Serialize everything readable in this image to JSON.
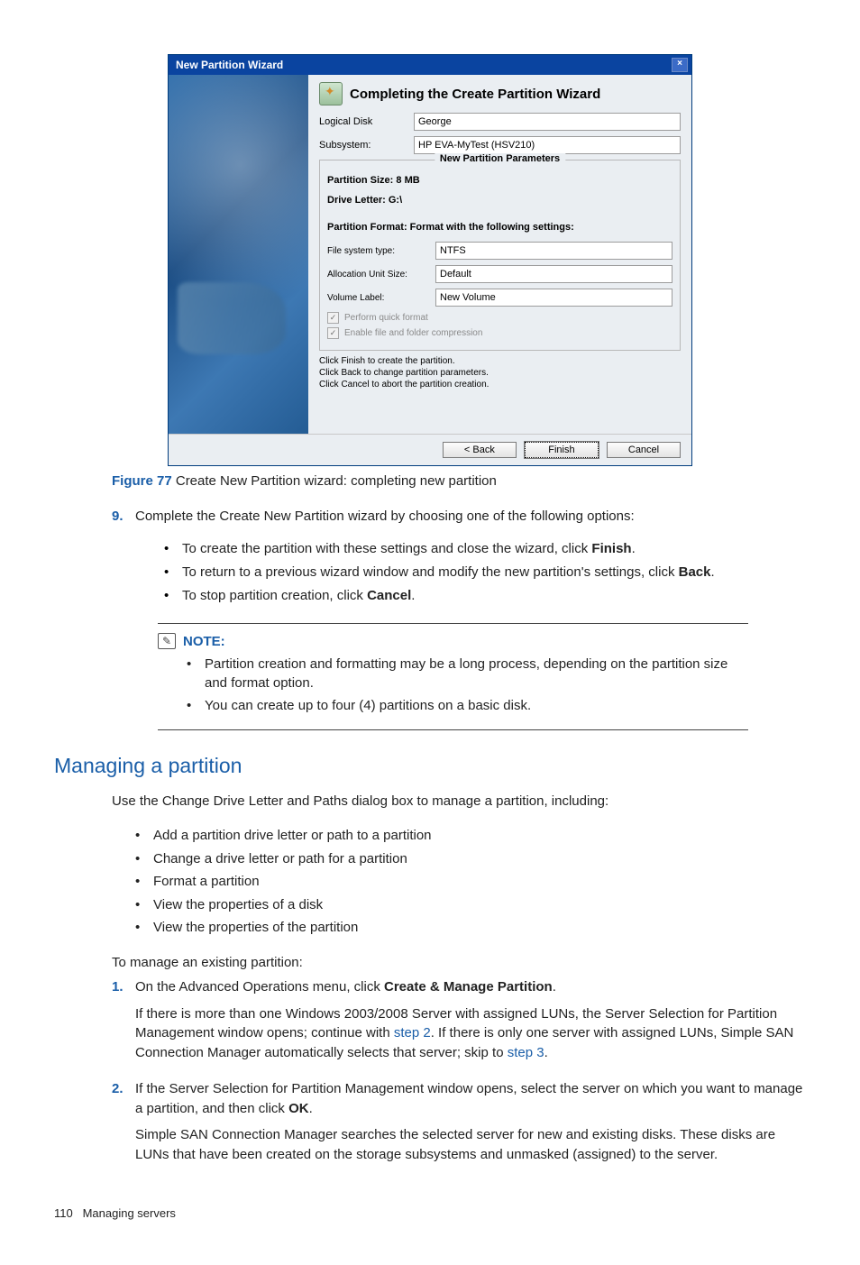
{
  "dialog": {
    "title": "New Partition Wizard",
    "close": "×",
    "header": "Completing the Create Partition Wizard",
    "logicalDisk_lbl": "Logical Disk",
    "logicalDisk_val": "George",
    "subsystem_lbl": "Subsystem:",
    "subsystem_val": "HP EVA-MyTest (HSV210)",
    "params_legend": "New Partition Parameters",
    "partSize": "Partition Size: 8 MB",
    "driveLetter": "Drive Letter: G:\\",
    "formatHeading": "Partition Format: Format with the following settings:",
    "fsType_lbl": "File system type:",
    "fsType_val": "NTFS",
    "alloc_lbl": "Allocation Unit Size:",
    "alloc_val": "Default",
    "volLabel_lbl": "Volume Label:",
    "volLabel_val": "New Volume",
    "quickFmt": "Perform quick format",
    "enableComp": "Enable file and folder compression",
    "hint1": "Click Finish to create the partition.",
    "hint2": "Click Back to change partition parameters.",
    "hint3": "Click Cancel to abort the partition creation.",
    "btnBack": "< Back",
    "btnFinish": "Finish",
    "btnCancel": "Cancel"
  },
  "figure": {
    "label": "Figure 77",
    "caption": " Create New Partition wizard: completing new partition"
  },
  "step9_num": "9.",
  "step9_text": "Complete the Create New Partition wizard by choosing one of the following options:",
  "step9_b1a": "To create the partition with these settings and close the wizard, click ",
  "step9_b1b": "Finish",
  "step9_b1c": ".",
  "step9_b2a": "To return to a previous wizard window and modify the new partition's settings, click ",
  "step9_b2b": "Back",
  "step9_b2c": ".",
  "step9_b3a": "To stop partition creation, click ",
  "step9_b3b": "Cancel",
  "step9_b3c": ".",
  "note": {
    "title": "NOTE:",
    "n1": "Partition creation and formatting may be a long process, depending on the partition size and format option.",
    "n2": "You can create up to four (4) partitions on a basic disk."
  },
  "sectionTitle": "Managing a partition",
  "mp_intro": "Use the Change Drive Letter and Paths dialog box to manage a partition, including:",
  "mp_b1": "Add a partition drive letter or path to a partition",
  "mp_b2": "Change a drive letter or path for a partition",
  "mp_b3": "Format a partition",
  "mp_b4": "View the properties of a disk",
  "mp_b5": "View the properties of the partition",
  "mp_toManage": "To manage an existing partition:",
  "ol2": {
    "n1": "1.",
    "t1a": "On the Advanced Operations menu, click ",
    "t1b": "Create & Manage Partition",
    "t1c": ".",
    "t1d_a": "If there is more than one Windows 2003/2008 Server with assigned LUNs, the Server Selection for Partition Management window opens; continue with ",
    "t1d_b": "step 2",
    "t1d_c": ". If there is only one server with assigned LUNs, Simple SAN Connection Manager automatically selects that server; skip to ",
    "t1d_d": "step 3",
    "t1d_e": ".",
    "n2": "2.",
    "t2a": "If the Server Selection for Partition Management window opens, select the server on which you want to manage a partition, and then click ",
    "t2b": "OK",
    "t2c": ".",
    "t2d": "Simple SAN Connection Manager searches the selected server for new and existing disks. These disks are LUNs that have been created on the storage subsystems and unmasked (assigned) to the server."
  },
  "footer": {
    "pageNum": "110",
    "section": "Managing servers"
  }
}
